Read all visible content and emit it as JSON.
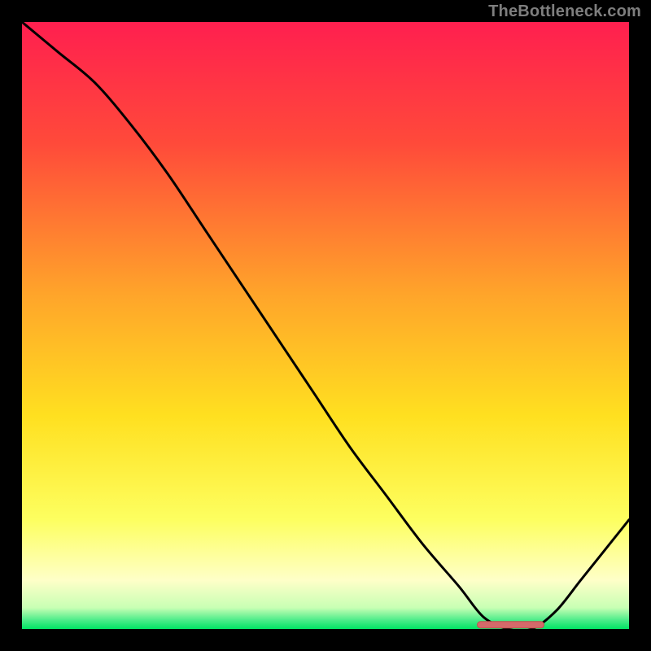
{
  "attribution": "TheBottleneck.com",
  "colors": {
    "page_bg": "#000000",
    "attribution_text": "#7e7e7e",
    "gradient_top": "#ff1f4f",
    "gradient_mid_upper": "#ff7a2a",
    "gradient_mid": "#ffe020",
    "gradient_lower": "#feffb0",
    "gradient_green": "#00e364",
    "curve_color": "#000000",
    "marker_fill": "#d46a6a",
    "marker_stroke": "#c24f4f"
  },
  "chart_data": {
    "type": "line",
    "title": "",
    "xlabel": "",
    "ylabel": "",
    "xlim": [
      0,
      100
    ],
    "ylim": [
      0,
      100
    ],
    "grid": false,
    "annotations": [],
    "series": [
      {
        "name": "bottleneck-curve",
        "x": [
          0,
          6,
          12,
          18,
          24,
          30,
          36,
          42,
          48,
          54,
          60,
          66,
          72,
          76,
          80,
          84,
          88,
          92,
          96,
          100
        ],
        "values": [
          100,
          95,
          90,
          83,
          75,
          66,
          57,
          48,
          39,
          30,
          22,
          14,
          7,
          2,
          0,
          0,
          3,
          8,
          13,
          18
        ]
      }
    ],
    "optimal_marker": {
      "x_start": 75,
      "x_end": 86,
      "y": 0.7
    },
    "background_gradient_stops": [
      {
        "offset": 0.0,
        "color": "#ff1f4f"
      },
      {
        "offset": 0.2,
        "color": "#ff4a3a"
      },
      {
        "offset": 0.45,
        "color": "#ffa52a"
      },
      {
        "offset": 0.65,
        "color": "#ffe020"
      },
      {
        "offset": 0.82,
        "color": "#fdff60"
      },
      {
        "offset": 0.92,
        "color": "#feffc8"
      },
      {
        "offset": 0.965,
        "color": "#c8ffb4"
      },
      {
        "offset": 0.985,
        "color": "#4eec8a"
      },
      {
        "offset": 1.0,
        "color": "#00e364"
      }
    ]
  }
}
